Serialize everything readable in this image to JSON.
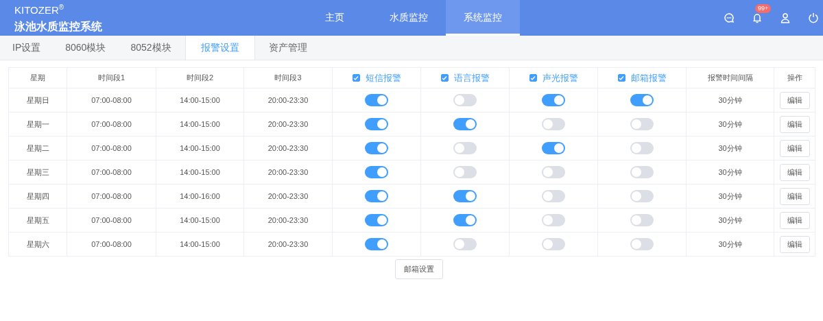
{
  "brand": {
    "name": "KITOZER",
    "mark": "®",
    "subtitle": "泳池水质监控系统"
  },
  "nav": [
    {
      "label": "主页",
      "selected": false
    },
    {
      "label": "水质监控",
      "selected": false
    },
    {
      "label": "系统监控",
      "selected": true
    }
  ],
  "header_icons": {
    "notification_badge": "99+"
  },
  "tabs": [
    {
      "label": "IP设置",
      "selected": false
    },
    {
      "label": "8060模块",
      "selected": false
    },
    {
      "label": "8052模块",
      "selected": false
    },
    {
      "label": "报警设置",
      "selected": true
    },
    {
      "label": "资产管理",
      "selected": false
    }
  ],
  "table": {
    "columns": [
      {
        "label": "星期",
        "kind": "text"
      },
      {
        "label": "时间段1",
        "kind": "text"
      },
      {
        "label": "时间段2",
        "kind": "text"
      },
      {
        "label": "时间段3",
        "kind": "text"
      },
      {
        "label": "短信报警",
        "kind": "check",
        "checked": true
      },
      {
        "label": "语言报警",
        "kind": "check",
        "checked": true
      },
      {
        "label": "声光报警",
        "kind": "check",
        "checked": true
      },
      {
        "label": "邮箱报警",
        "kind": "check",
        "checked": true
      },
      {
        "label": "报警时间间隔",
        "kind": "text"
      },
      {
        "label": "操作",
        "kind": "text"
      }
    ],
    "rows": [
      {
        "day": "星期日",
        "period1": "07:00-08:00",
        "period2": "14:00-15:00",
        "period3": "20:00-23:30",
        "switches": [
          true,
          false,
          true,
          true
        ],
        "interval": "30分钟",
        "action": "编辑"
      },
      {
        "day": "星期一",
        "period1": "07:00-08:00",
        "period2": "14:00-15:00",
        "period3": "20:00-23:30",
        "switches": [
          true,
          true,
          false,
          false
        ],
        "interval": "30分钟",
        "action": "编辑"
      },
      {
        "day": "星期二",
        "period1": "07:00-08:00",
        "period2": "14:00-15:00",
        "period3": "20:00-23:30",
        "switches": [
          true,
          false,
          true,
          false
        ],
        "interval": "30分钟",
        "action": "编辑"
      },
      {
        "day": "星期三",
        "period1": "07:00-08:00",
        "period2": "14:00-15:00",
        "period3": "20:00-23:30",
        "switches": [
          true,
          false,
          false,
          false
        ],
        "interval": "30分钟",
        "action": "编辑"
      },
      {
        "day": "星期四",
        "period1": "07:00-08:00",
        "period2": "14:00-16:00",
        "period3": "20:00-23:30",
        "switches": [
          true,
          true,
          false,
          false
        ],
        "interval": "30分钟",
        "action": "编辑"
      },
      {
        "day": "星期五",
        "period1": "07:00-08:00",
        "period2": "14:00-15:00",
        "period3": "20:00-23:30",
        "switches": [
          true,
          true,
          false,
          false
        ],
        "interval": "30分钟",
        "action": "编辑"
      },
      {
        "day": "星期六",
        "period1": "07:00-08:00",
        "period2": "14:00-15:00",
        "period3": "20:00-23:30",
        "switches": [
          true,
          false,
          false,
          false
        ],
        "interval": "30分钟",
        "action": "编辑"
      }
    ]
  },
  "footer_button": "邮箱设置"
}
